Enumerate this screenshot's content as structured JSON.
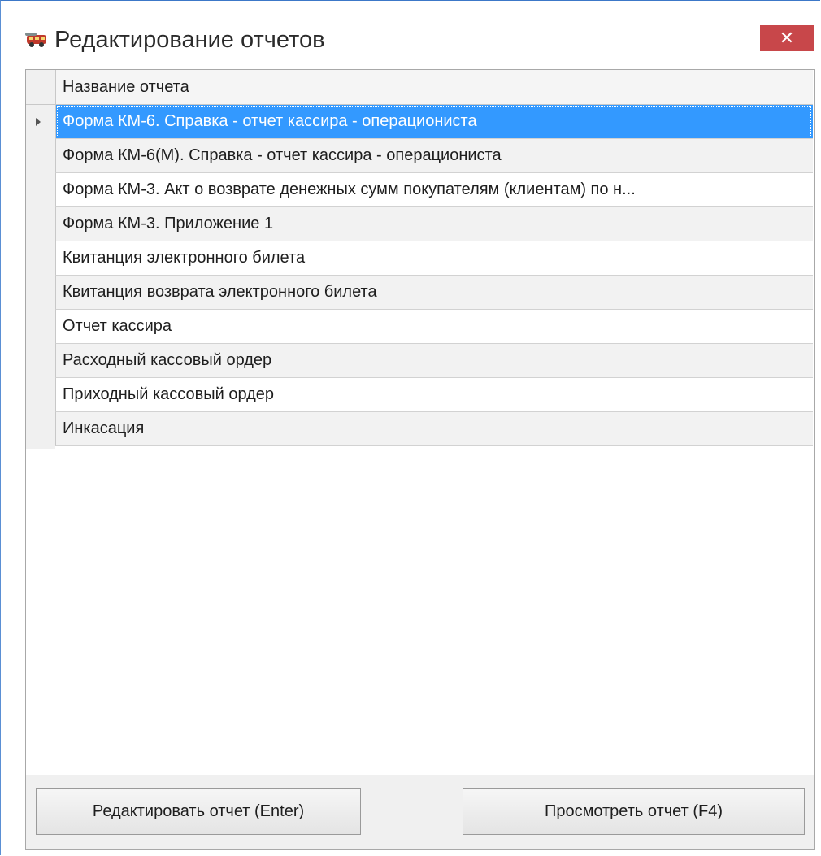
{
  "window": {
    "title": "Редактирование отчетов",
    "app_icon": "train-icon",
    "close_label": "✕"
  },
  "grid": {
    "column_header": "Название отчета",
    "selected_index": 0,
    "rows": [
      {
        "name": "Форма КМ-6. Справка - отчет кассира - операциониста"
      },
      {
        "name": "Форма КМ-6(М). Справка - отчет кассира - операциониста"
      },
      {
        "name": "Форма КМ-3. Акт о возврате денежных сумм покупателям (клиентам) по н..."
      },
      {
        "name": "Форма КМ-3. Приложение 1"
      },
      {
        "name": "Квитанция электронного билета"
      },
      {
        "name": "Квитанция возврата электронного билета"
      },
      {
        "name": "Отчет кассира"
      },
      {
        "name": "Расходный кассовый ордер"
      },
      {
        "name": "Приходный кассовый ордер"
      },
      {
        "name": "Инкасация"
      }
    ]
  },
  "buttons": {
    "edit_label": "Редактировать отчет (Enter)",
    "view_label": "Просмотреть отчет (F4)"
  },
  "colors": {
    "selection": "#3399ff",
    "close_button": "#c8474a",
    "window_border": "#3c78c8"
  }
}
